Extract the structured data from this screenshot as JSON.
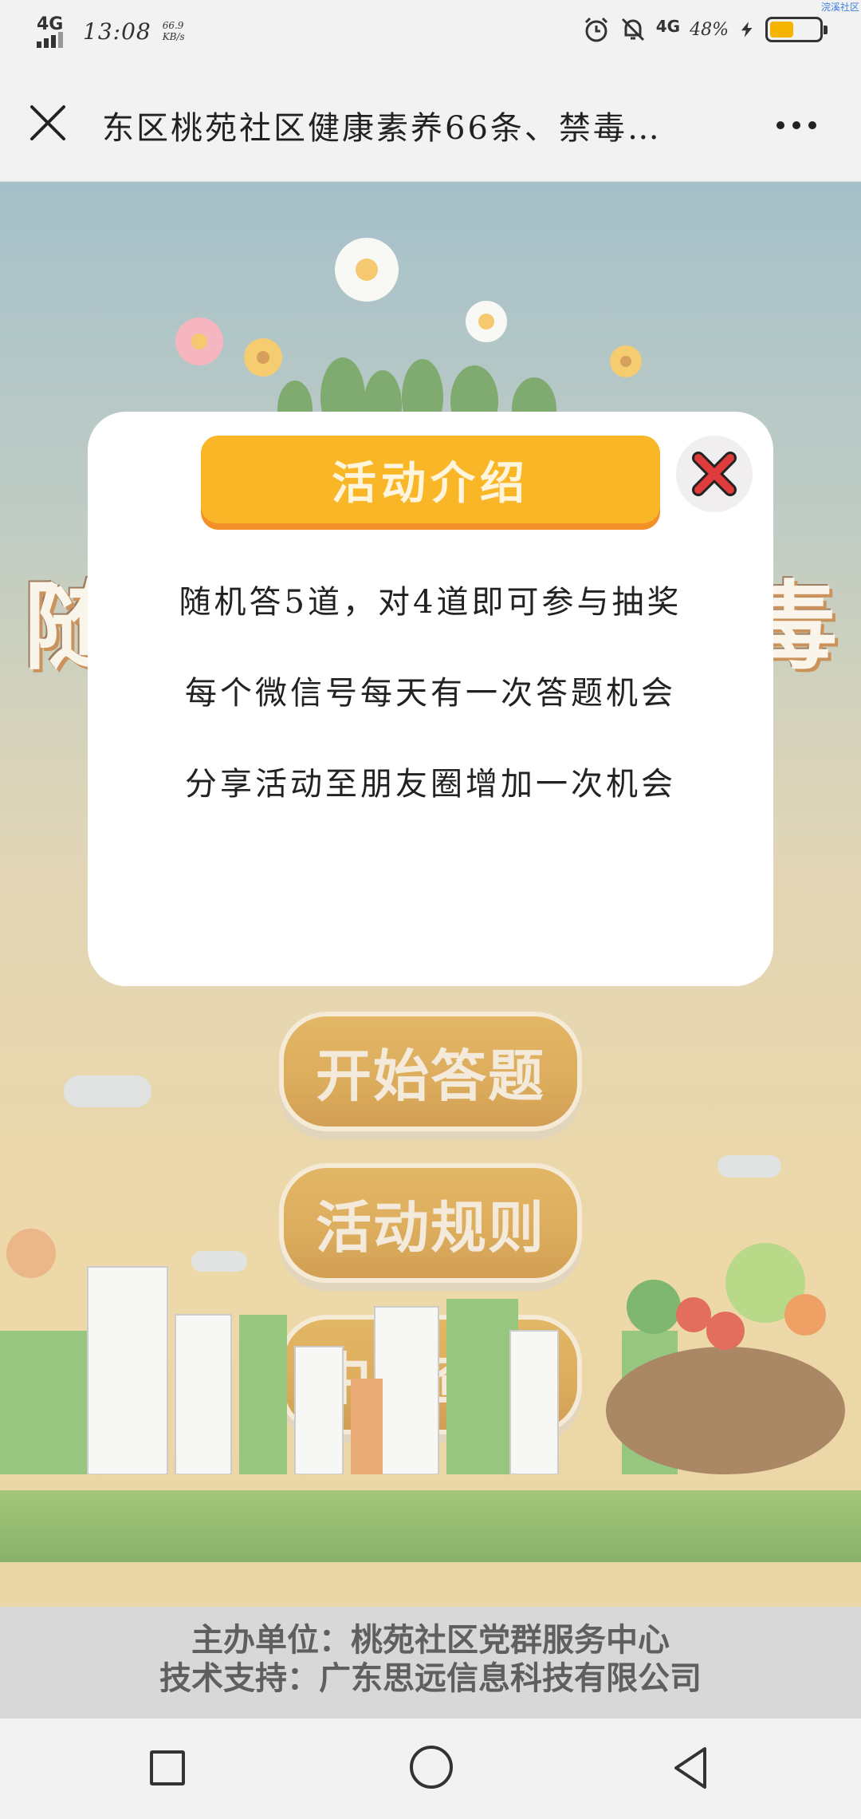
{
  "status_bar": {
    "network": "4G",
    "time": "13:08",
    "speed_value": "66.9",
    "speed_unit": "KB/s",
    "network_right": "4G",
    "battery_percent": "48%",
    "battery_level": 0.48,
    "battery_color": "#f5b400",
    "corner_tag": "浣溪社区",
    "icons": [
      "signal-icon",
      "alarm-icon",
      "mute-icon",
      "charging-icon",
      "battery-icon"
    ]
  },
  "title_bar": {
    "title": "东区桃苑社区健康素养66条、禁毒…",
    "close_icon": "close-icon",
    "more_icon": "more-icon"
  },
  "background": {
    "banner_left": "随",
    "banner_right": "毒",
    "menu": [
      {
        "label": "开始答题"
      },
      {
        "label": "活动规则"
      },
      {
        "label": "中奖查询"
      }
    ]
  },
  "modal": {
    "header": "活动介绍",
    "close_icon": "close-red-x-icon",
    "lines": [
      "随机答5道，对4道即可参与抽奖",
      "每个微信号每天有一次答题机会",
      "分享活动至朋友圈增加一次机会"
    ],
    "accent_color": "#f9b627",
    "close_color": "#e03b3b"
  },
  "footer": {
    "organizer": "主办单位：桃苑社区党群服务中心",
    "tech_support": "技术支持：广东思远信息科技有限公司"
  },
  "nav_bar": {
    "icons": [
      "recent-apps-icon",
      "home-icon",
      "back-icon"
    ]
  }
}
